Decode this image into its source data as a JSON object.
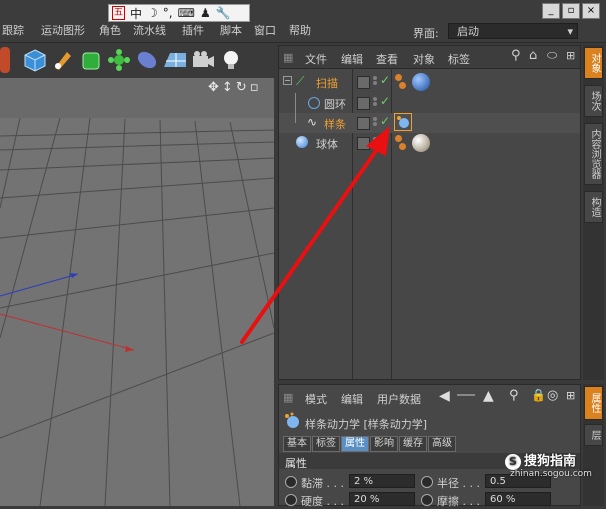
{
  "menu": {
    "items": [
      "跟踪",
      "运动图形",
      "角色",
      "流水线",
      "插件",
      "脚本",
      "窗口",
      "帮助"
    ]
  },
  "ime": {
    "badge": "五",
    "mode": "中",
    "moon": "☽",
    "punct": "°,",
    "keyboard": "⌨",
    "user": "♟",
    "tool": "🔧"
  },
  "window_buttons": [
    "_",
    "▫",
    "×"
  ],
  "layout": {
    "label": "界面:",
    "value": "启动"
  },
  "object_manager": {
    "menus": [
      "文件",
      "编辑",
      "查看",
      "对象",
      "标签"
    ],
    "objects": [
      {
        "name": "扫描",
        "highlight": true
      },
      {
        "name": "圆环",
        "highlight": false
      },
      {
        "name": "样条",
        "highlight": true
      },
      {
        "name": "球体",
        "highlight": false
      }
    ]
  },
  "right_tabs": [
    "对象",
    "场次",
    "内容浏览器",
    "构造"
  ],
  "attribute_manager": {
    "menus": [
      "模式",
      "编辑",
      "用户数据"
    ],
    "title": "样条动力学 [样条动力学]",
    "tabs": [
      "基本",
      "标签",
      "属性",
      "影响",
      "缓存",
      "高级"
    ],
    "active_tab": "属性",
    "section": "属性",
    "fields": [
      {
        "label": "黏滞 . . .",
        "value": "2 %"
      },
      {
        "label": "半径 . . .",
        "value": "0.5"
      },
      {
        "label": "硬度 . . .",
        "value": "20 %"
      },
      {
        "label": "摩擦 . . .",
        "value": "60 %"
      }
    ]
  },
  "right_tabs_2": [
    "属性",
    "层"
  ],
  "watermark": {
    "brand": "搜狗指南",
    "url": "zhinan.sogou.com"
  },
  "colors": {
    "accent": "#d9821f",
    "arrow": "#e81010",
    "active_tab": "#5a8fc4"
  }
}
